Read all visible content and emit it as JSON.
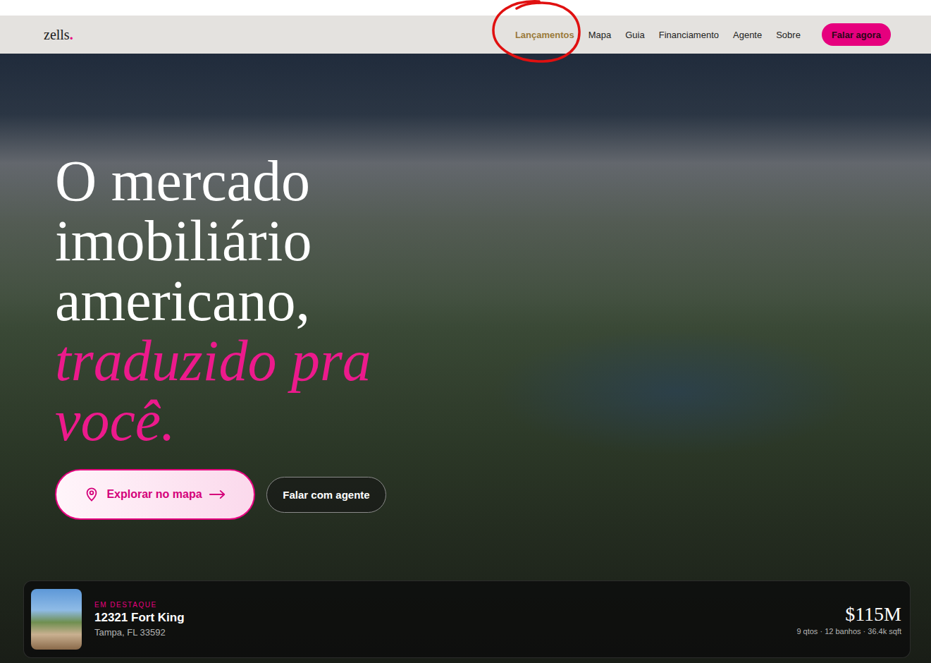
{
  "nav": {
    "logo": {
      "name": "zells",
      "dot": "."
    },
    "items": [
      {
        "label": "Lançamentos",
        "selected": true,
        "circled": true
      },
      {
        "label": "Mapa",
        "selected": false,
        "circled": false
      },
      {
        "label": "Guia",
        "selected": false,
        "circled": false
      },
      {
        "label": "Financiamento",
        "selected": false,
        "circled": false
      },
      {
        "label": "Agente",
        "selected": false,
        "circled": false
      },
      {
        "label": "Sobre",
        "selected": false,
        "circled": false
      }
    ],
    "cta": "Falar agora"
  },
  "hero": {
    "headline": [
      {
        "text": "O mercado",
        "accent": false
      },
      {
        "text": "imobiliário",
        "accent": false
      },
      {
        "text": "americano,",
        "accent": false
      },
      {
        "text": "traduzido pra",
        "accent": true
      },
      {
        "text": "você.",
        "accent": true
      }
    ],
    "buttons": [
      {
        "label": "Explorar no mapa",
        "kind": "primary"
      },
      {
        "label": "Falar com agente",
        "kind": "secondary"
      }
    ]
  },
  "featured": {
    "eyebrow": "EM DESTAQUE",
    "title": "12321 Fort King",
    "location": "Tampa, FL 33592",
    "price": "$115M",
    "details": "9 qtos · 12 banhos · 36.4k sqft"
  }
}
